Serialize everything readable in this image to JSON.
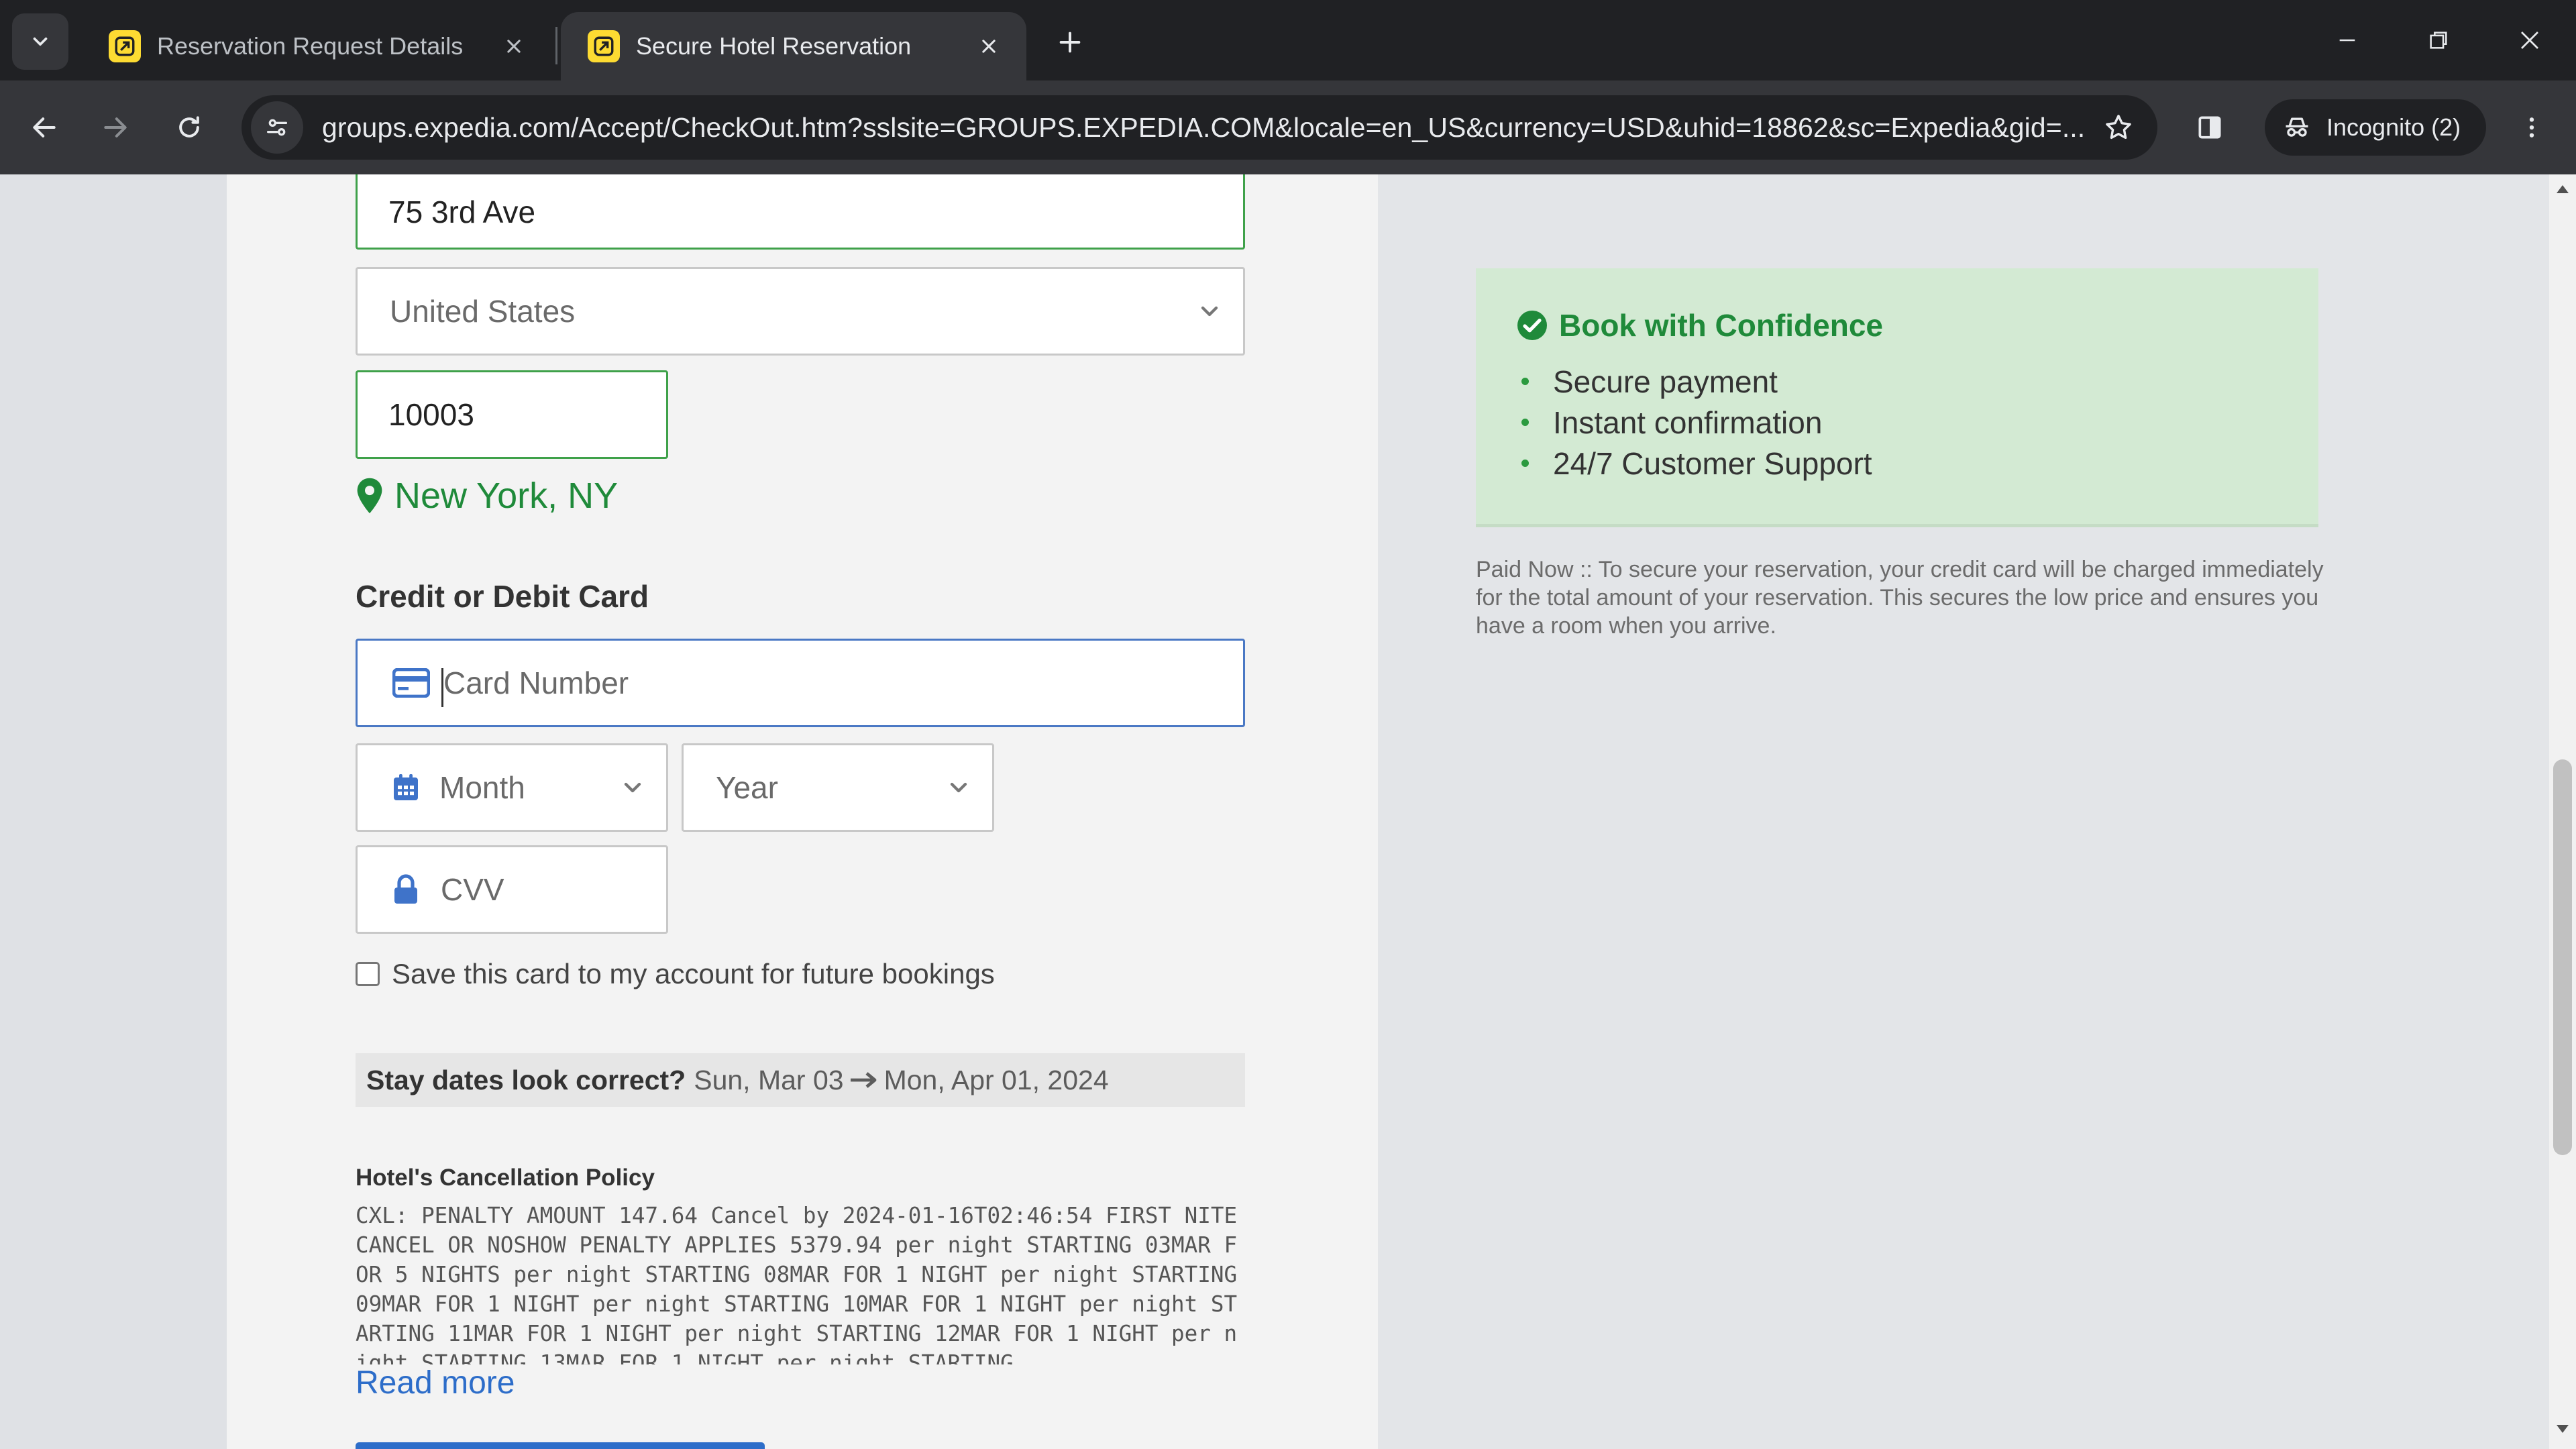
{
  "browser": {
    "tabs": [
      {
        "title": "Reservation Request Details",
        "active": false
      },
      {
        "title": "Secure Hotel Reservation",
        "active": true
      }
    ],
    "url": "groups.expedia.com/Accept/CheckOut.htm?sslsite=GROUPS.EXPEDIA.COM&locale=en_US&currency=USD&uhid=18862&sc=Expedia&gid=...",
    "incognito_label": "Incognito (2)",
    "colors": {
      "chrome_dark": "#202124",
      "chrome_mid": "#35363a",
      "favicon": "#fddb32"
    }
  },
  "address": {
    "street_value": "75 3rd Ave",
    "country_value": "United States",
    "zip_value": "10003",
    "city_state": "New York, NY"
  },
  "payment": {
    "section_title": "Credit or Debit Card",
    "card_number_placeholder": "Card Number",
    "month_placeholder": "Month",
    "year_placeholder": "Year",
    "cvv_placeholder": "CVV",
    "save_card_label": "Save this card to my account for future bookings",
    "save_card_checked": false
  },
  "stay": {
    "question": "Stay dates look correct?",
    "check_in": "Sun, Mar 03",
    "check_out": "Mon, Apr 01, 2024"
  },
  "policy": {
    "title": "Hotel's Cancellation Policy",
    "text": "CXL: PENALTY AMOUNT 147.64 Cancel by 2024-01-16T02:46:54 FIRST NITE CANCEL OR NOSHOW PENALTY APPLIES 5379.94 per night STARTING 03MAR FOR 5 NIGHTS per night STARTING 08MAR FOR 1 NIGHT per night STARTING 09MAR FOR 1 NIGHT per night STARTING 10MAR FOR 1 NIGHT per night STARTING 11MAR FOR 1 NIGHT per night STARTING 12MAR FOR 1 NIGHT per night STARTING 13MAR FOR 1 NIGHT per night STARTING",
    "read_more": "Read more"
  },
  "confidence": {
    "heading": "Book with Confidence",
    "items": [
      "Secure payment",
      "Instant confirmation",
      "24/7 Customer Support"
    ]
  },
  "paid_note": "Paid Now :: To secure your reservation, your credit card will be charged immediately for the total amount of your reservation. This secures the low price and ensures you have a room when you arrive.",
  "colors": {
    "success_green": "#1f8a3a",
    "link_blue": "#2d6dc9",
    "panel_green": "#d3ead3",
    "valid_border": "#3fa14a",
    "focus_border": "#4a78c4"
  }
}
